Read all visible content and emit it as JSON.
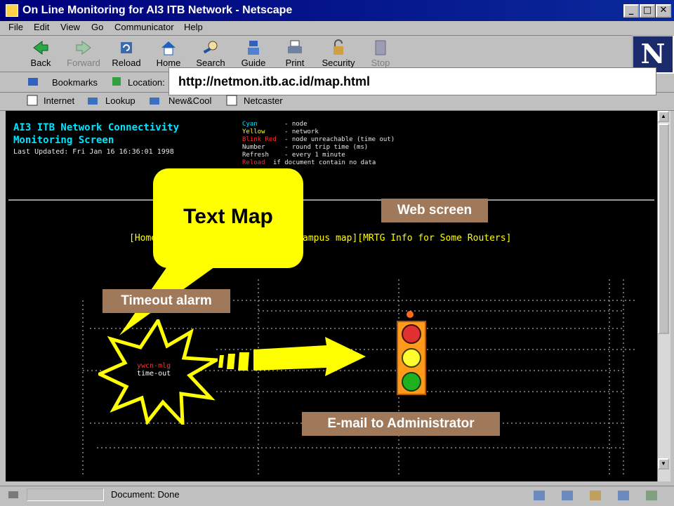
{
  "window": {
    "title": "On Line Monitoring for AI3 ITB Network - Netscape"
  },
  "menu": [
    "File",
    "Edit",
    "View",
    "Go",
    "Communicator",
    "Help"
  ],
  "toolbar": [
    {
      "label": "Back",
      "icon": "back-icon"
    },
    {
      "label": "Forward",
      "icon": "forward-icon"
    },
    {
      "label": "Reload",
      "icon": "reload-icon"
    },
    {
      "label": "Home",
      "icon": "home-icon"
    },
    {
      "label": "Search",
      "icon": "search-icon"
    },
    {
      "label": "Guide",
      "icon": "guide-icon"
    },
    {
      "label": "Print",
      "icon": "print-icon"
    },
    {
      "label": "Security",
      "icon": "security-icon"
    },
    {
      "label": "Stop",
      "icon": "stop-icon"
    }
  ],
  "location": {
    "bookmarks": "Bookmarks",
    "label": "Location:",
    "url": "http://netmon.itb.ac.id/map.html"
  },
  "personal": [
    "Internet",
    "Lookup",
    "New&Cool",
    "Netcaster"
  ],
  "page": {
    "title1": "AI3 ITB Network Connectivity",
    "title2": "Monitoring Screen",
    "updated": "Last Updated: Fri Jan 16 16:36:01 1998",
    "legend": [
      {
        "k": "Cyan",
        "v": "- node"
      },
      {
        "k": "Yellow",
        "v": "- network"
      },
      {
        "k": "Blink Red",
        "v": "- node unreachable (time out)"
      },
      {
        "k": "Number",
        "v": "- round trip time (ms)"
      },
      {
        "k": "Refresh",
        "v": "- every 1 minute"
      },
      {
        "k": "Reload",
        "v": "if document contain no data"
      }
    ],
    "nav_home": "[Home",
    "nav_campus": "ampus map][MRTG Info for Some Routers]"
  },
  "callouts": {
    "text_map": "Text Map",
    "web_screen": "Web screen",
    "timeout_alarm": "Timeout alarm",
    "email_admin": "E-mail to Administrator",
    "alert_node": "ywcn-mlg",
    "alert_status": "time-out"
  },
  "status": {
    "text": "Document: Done"
  },
  "colors": {
    "titlebar": "#00007b",
    "screen": "#000000",
    "callout_label": "#a0785a",
    "bubble": "#ffff00"
  }
}
